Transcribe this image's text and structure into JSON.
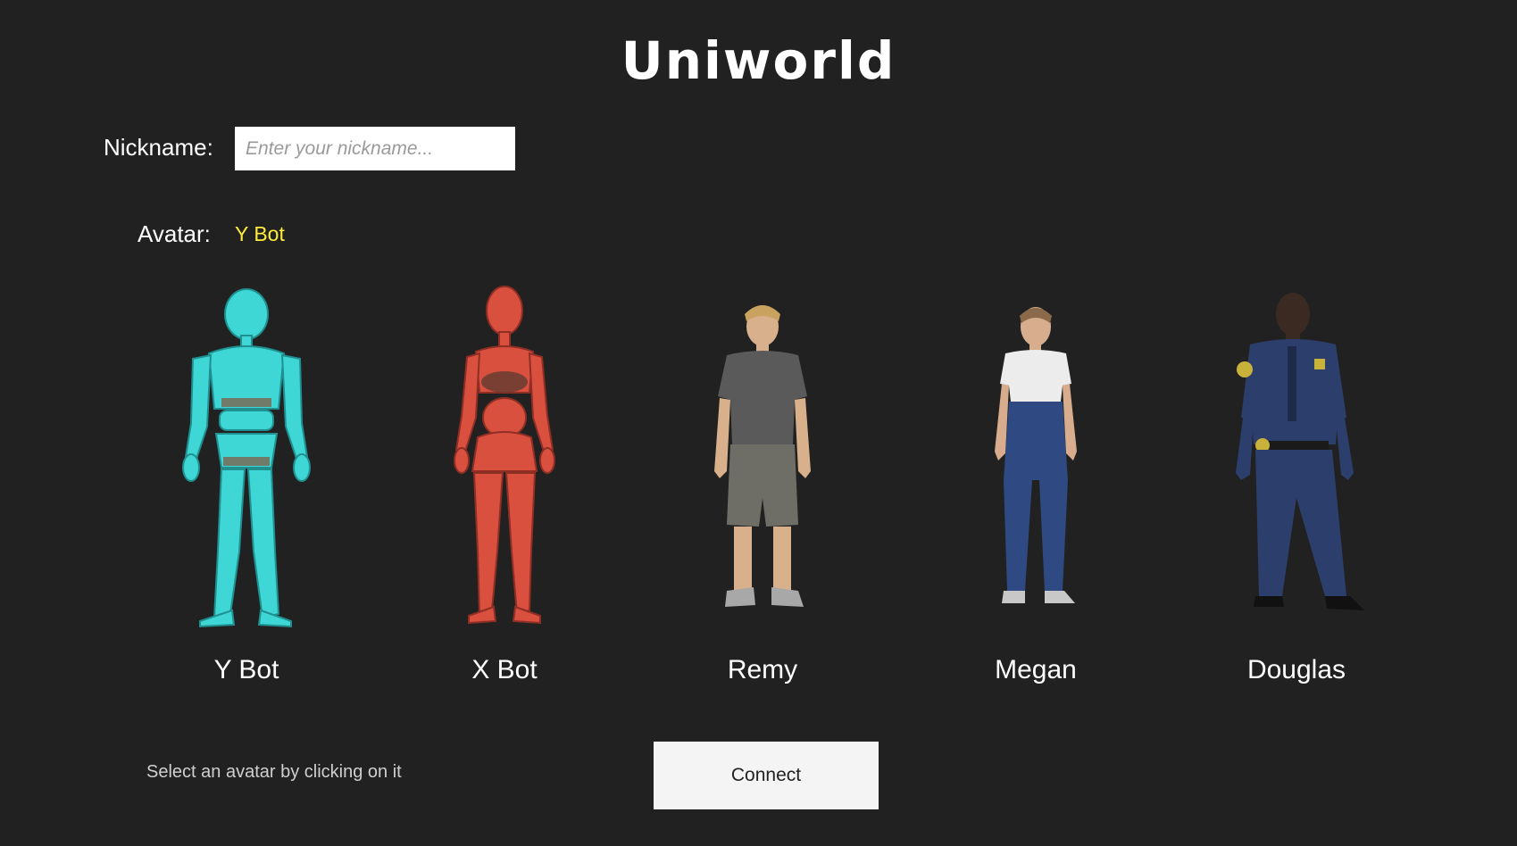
{
  "app": {
    "title": "Uniworld"
  },
  "nickname": {
    "label": "Nickname:",
    "value": "",
    "placeholder": "Enter your nickname..."
  },
  "avatar": {
    "label": "Avatar:",
    "selected": "Y Bot"
  },
  "avatars": [
    {
      "name": "Y Bot",
      "style": "robot",
      "color": "#3fd6d6"
    },
    {
      "name": "X Bot",
      "style": "robot",
      "color": "#d9503f"
    },
    {
      "name": "Remy",
      "style": "human-male-casual",
      "color": "#5a5a5a"
    },
    {
      "name": "Megan",
      "style": "human-female-casual",
      "color": "#2f4a82"
    },
    {
      "name": "Douglas",
      "style": "human-male-uniform",
      "color": "#2c3e6b"
    }
  ],
  "footer": {
    "hint": "Select an avatar by clicking on it",
    "connect_label": "Connect"
  },
  "colors": {
    "background": "#212121",
    "accent_selected": "#ffeb3b",
    "button_bg": "#f4f4f4"
  }
}
